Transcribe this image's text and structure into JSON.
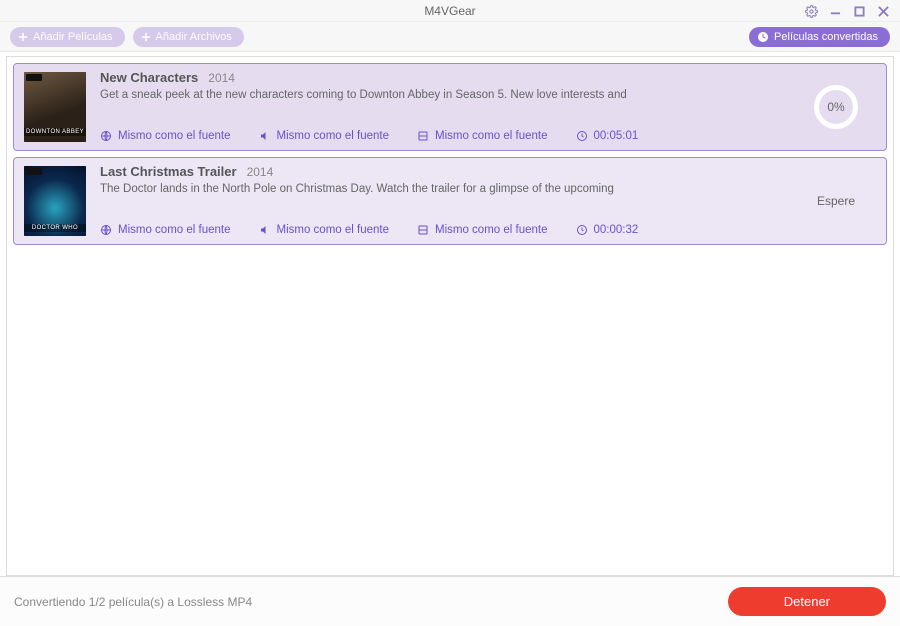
{
  "app": {
    "title": "M4VGear"
  },
  "toolbar": {
    "add_movies": "Añadir Películas",
    "add_files": "Añadir Archivos",
    "converted": "Películas convertidas"
  },
  "items": [
    {
      "title": "New Characters",
      "year": "2014",
      "desc": "Get a sneak peek at the new characters coming to Downton Abbey in Season 5. New love interests and",
      "sub": "Mismo como el fuente",
      "audio": "Mismo como el fuente",
      "video": "Mismo como el fuente",
      "duration": "00:05:01",
      "status_type": "progress",
      "progress_label": "0%",
      "thumb_label": "DOWNTON ABBEY"
    },
    {
      "title": "Last Christmas Trailer",
      "year": "2014",
      "desc": "The Doctor lands in the North Pole on Christmas Day. Watch the trailer for a glimpse of the upcoming",
      "sub": "Mismo como el fuente",
      "audio": "Mismo como el fuente",
      "video": "Mismo como el fuente",
      "duration": "00:00:32",
      "status_type": "wait",
      "wait_label": "Espere",
      "thumb_label": "DOCTOR WHO"
    }
  ],
  "footer": {
    "status": "Convertiendo 1/2 película(s) a Lossless MP4",
    "stop": "Detener"
  }
}
